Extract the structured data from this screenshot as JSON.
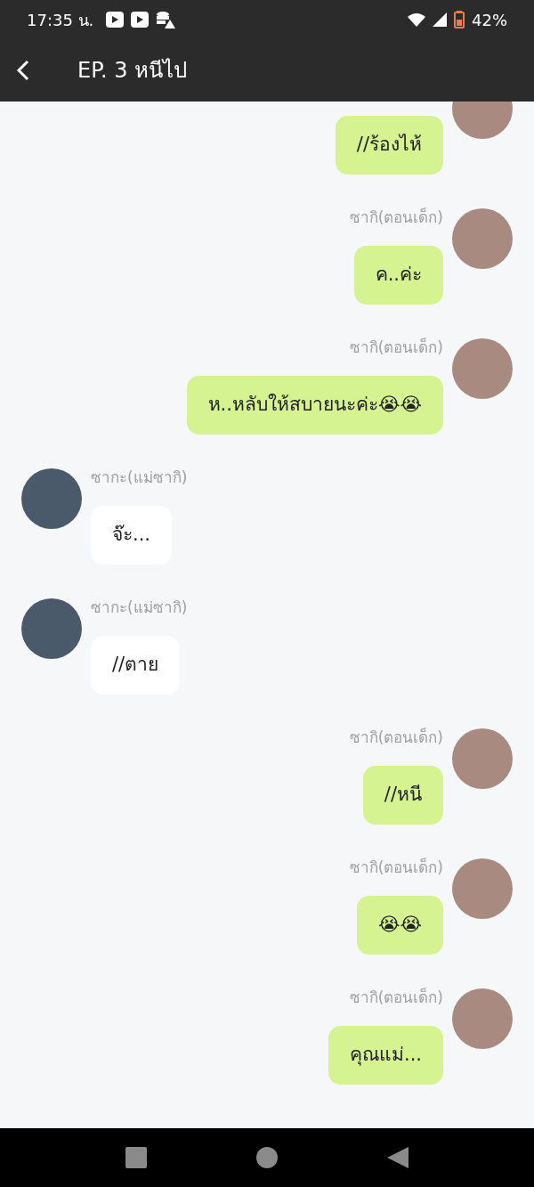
{
  "status_bar": {
    "time": "17:35 น.",
    "battery": "42%"
  },
  "header": {
    "title": "EP. 3 หนีไป"
  },
  "messages": [
    {
      "kind": "outgoing",
      "text": "//ร้องไห้"
    },
    {
      "kind": "outgoing",
      "name": "ซากิ(ตอนเด็ก)",
      "text": "ค..ค่ะ"
    },
    {
      "kind": "outgoing",
      "name": "ซากิ(ตอนเด็ก)",
      "text": "ห..หลับให้สบายนะค่ะ😭😭"
    },
    {
      "kind": "incoming",
      "name": "ซากะ(แม่ซากิ)",
      "text": "จ๊ะ..."
    },
    {
      "kind": "incoming",
      "name": "ซากะ(แม่ซากิ)",
      "text": "//ตาย"
    },
    {
      "kind": "outgoing",
      "name": "ซากิ(ตอนเด็ก)",
      "text": "//หนี"
    },
    {
      "kind": "outgoing",
      "name": "ซากิ(ตอนเด็ก)",
      "text": "😭😭"
    },
    {
      "kind": "outgoing",
      "name": "ซากิ(ตอนเด็ก)",
      "text": "คุณแม่..."
    }
  ]
}
